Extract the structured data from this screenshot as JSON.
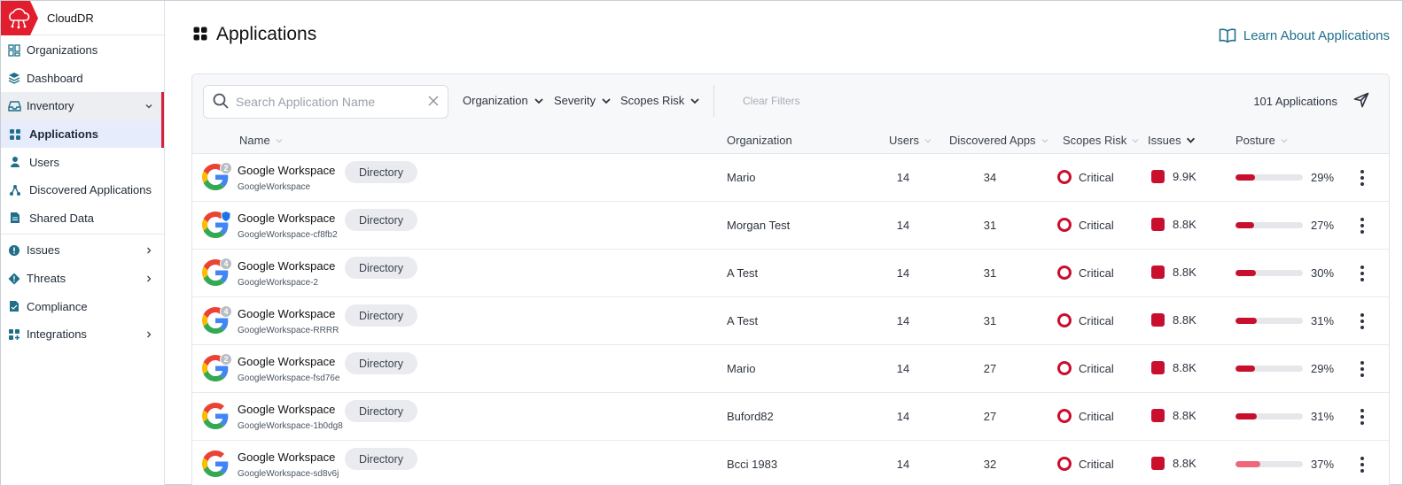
{
  "app": {
    "name": "CloudDR"
  },
  "sidebar": {
    "items": [
      {
        "label": "Organizations",
        "icon": "grid-dashboard-icon"
      },
      {
        "label": "Dashboard",
        "icon": "layers-icon"
      },
      {
        "label": "Inventory",
        "icon": "inbox-icon",
        "expanded": true
      },
      {
        "label": "Applications",
        "icon": "apps-icon",
        "active": true
      },
      {
        "label": "Users",
        "icon": "user-icon"
      },
      {
        "label": "Discovered Applications",
        "icon": "network-icon"
      },
      {
        "label": "Shared Data",
        "icon": "document-icon"
      },
      {
        "label": "Issues",
        "icon": "alert-circle-icon"
      },
      {
        "label": "Threats",
        "icon": "threat-diamond-icon"
      },
      {
        "label": "Compliance",
        "icon": "compliance-doc-icon"
      },
      {
        "label": "Integrations",
        "icon": "integrations-icon"
      }
    ]
  },
  "header": {
    "title": "Applications",
    "learn_link": "Learn About Applications"
  },
  "toolbar": {
    "search_placeholder": "Search Application Name",
    "filters": [
      "Organization",
      "Severity",
      "Scopes Risk"
    ],
    "clear_filters": "Clear Filters",
    "count_label": "101 Applications"
  },
  "table": {
    "columns": [
      "Name",
      "Organization",
      "Users",
      "Discovered Apps",
      "Scopes Risk",
      "Issues",
      "Posture"
    ],
    "sorted_column": "Issues",
    "rows": [
      {
        "name": "Google Workspace",
        "sub": "GoogleWorkspace",
        "tag": "Directory",
        "badge": "2",
        "organization": "Mario",
        "users": "14",
        "discovered": "34",
        "risk": "Critical",
        "issues": "9.9K",
        "posture_label": "29%",
        "posture": 0.29
      },
      {
        "name": "Google Workspace",
        "sub": "GoogleWorkspace-cf8fb2",
        "tag": "Directory",
        "badge": "blue",
        "organization": "Morgan Test",
        "users": "14",
        "discovered": "31",
        "risk": "Critical",
        "issues": "8.8K",
        "posture_label": "27%",
        "posture": 0.27
      },
      {
        "name": "Google Workspace",
        "sub": "GoogleWorkspace-2",
        "tag": "Directory",
        "badge": "4",
        "organization": "A Test",
        "users": "14",
        "discovered": "31",
        "risk": "Critical",
        "issues": "8.8K",
        "posture_label": "30%",
        "posture": 0.3
      },
      {
        "name": "Google Workspace",
        "sub": "GoogleWorkspace-RRRR",
        "tag": "Directory",
        "badge": "4",
        "organization": "A Test",
        "users": "14",
        "discovered": "31",
        "risk": "Critical",
        "issues": "8.8K",
        "posture_label": "31%",
        "posture": 0.31
      },
      {
        "name": "Google Workspace",
        "sub": "GoogleWorkspace-fsd76e",
        "tag": "Directory",
        "badge": "2",
        "organization": "Mario",
        "users": "14",
        "discovered": "27",
        "risk": "Critical",
        "issues": "8.8K",
        "posture_label": "29%",
        "posture": 0.29
      },
      {
        "name": "Google Workspace",
        "sub": "GoogleWorkspace-1b0dg8",
        "tag": "Directory",
        "badge": "",
        "organization": "Buford82",
        "users": "14",
        "discovered": "27",
        "risk": "Critical",
        "issues": "8.8K",
        "posture_label": "31%",
        "posture": 0.31
      },
      {
        "name": "Google Workspace",
        "sub": "GoogleWorkspace-sd8v6j",
        "tag": "Directory",
        "badge": "",
        "organization": "Bcci 1983",
        "users": "14",
        "discovered": "32",
        "risk": "Critical",
        "issues": "8.8K",
        "posture_label": "37%",
        "posture": 0.37,
        "posture_light": true
      }
    ]
  },
  "colors": {
    "brand": "#e11d2e",
    "critical": "#c8102e",
    "link": "#1f6f8b",
    "active_bg": "#e6ecfb"
  }
}
